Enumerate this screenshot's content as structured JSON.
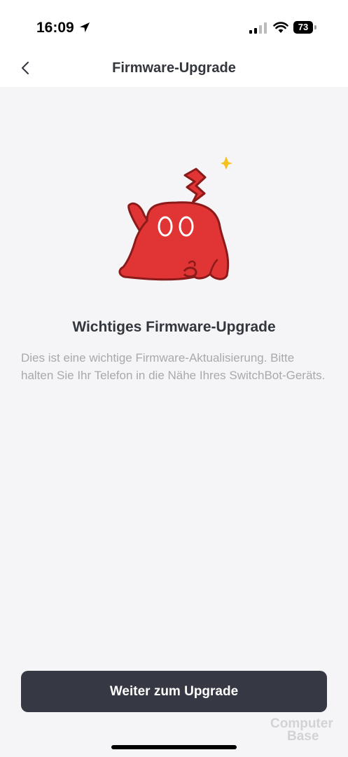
{
  "status_bar": {
    "time": "16:09",
    "battery_level": "73",
    "icons": [
      "location-arrow-icon",
      "cellular-signal-icon",
      "wifi-icon",
      "battery-icon"
    ]
  },
  "nav": {
    "title": "Firmware-Upgrade",
    "back_icon": "chevron-left-icon"
  },
  "main": {
    "illustration": "red-mascot-illustration",
    "headline": "Wichtiges Firmware-Upgrade",
    "description": "Dies ist eine wichtige Firmware-Aktualisierung. Bitte halten Sie Ihr Telefon in die Nähe Ihres SwitchBot-Geräts."
  },
  "cta": {
    "label": "Weiter zum Upgrade"
  },
  "watermark": {
    "line1": "Computer",
    "line2": "Base"
  },
  "colors": {
    "background": "#f5f5f7",
    "header": "#ffffff",
    "button": "#363843",
    "mascot_red": "#e03534",
    "text_dark": "#33363d",
    "text_muted": "#a8a9ad"
  }
}
